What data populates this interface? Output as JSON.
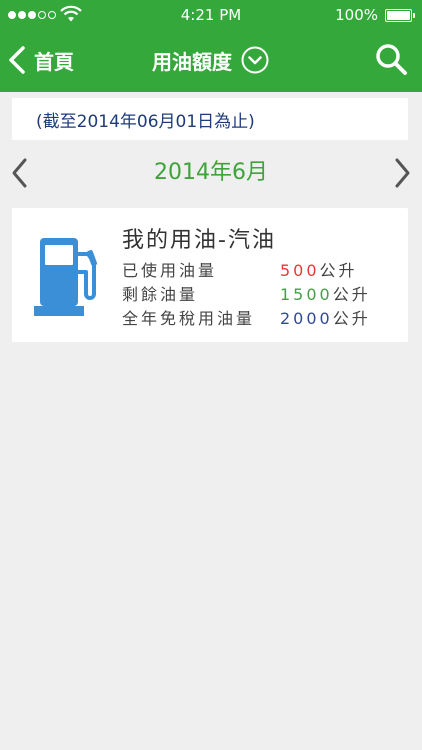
{
  "status_bar": {
    "time": "4:21 PM",
    "battery_percent": "100%",
    "signal_filled": 3,
    "signal_total": 5
  },
  "nav": {
    "back_label": "首頁",
    "title": "用油額度",
    "title_icon": "chevron-down-circle-icon",
    "search_icon": "search-icon"
  },
  "date_note": "(截至2014年06月01日為止)",
  "month_selector": {
    "label": "2014年6月",
    "prev_icon": "chevron-left-icon",
    "next_icon": "chevron-right-icon"
  },
  "fuel_card": {
    "icon": "fuel-pump-icon",
    "title": "我的用油-汽油",
    "rows": [
      {
        "label": "已使用油量",
        "value": "500",
        "unit": "公升",
        "color": "#e53935"
      },
      {
        "label": "剩餘油量",
        "value": "1500",
        "unit": "公升",
        "color": "#43a047"
      },
      {
        "label": "全年免稅用油量",
        "value": "2000",
        "unit": "公升",
        "color": "#2f4a9b"
      }
    ]
  },
  "colors": {
    "brand_green": "#34a83a",
    "month_green": "#3fa33b",
    "pump_blue": "#3b8fd6",
    "note_blue": "#1f3c7a",
    "background": "#efefef"
  }
}
